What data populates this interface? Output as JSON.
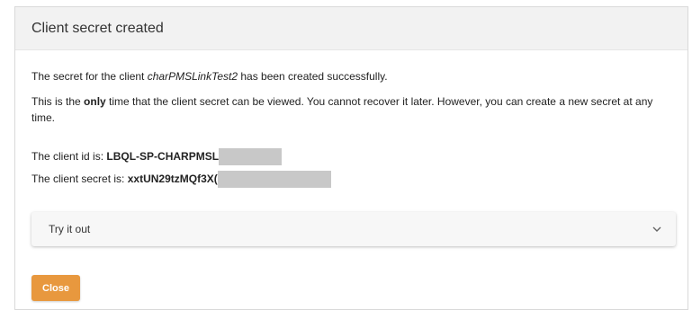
{
  "dialog": {
    "title": "Client secret created",
    "message": {
      "prefix": "The secret for the client ",
      "client_name": "charPMSLinkTest2",
      "suffix": " has been created successfully."
    },
    "warning": {
      "prefix": "This is the ",
      "emphasis": "only",
      "suffix": " time that the client secret can be viewed. You cannot recover it later. However, you can create a new secret at any time."
    },
    "client_id": {
      "label": "The client id is: ",
      "value": "LBQL-SP-CHARPMSL"
    },
    "client_secret": {
      "label": "The client secret is: ",
      "value": "xxtUN29tzMQf3X("
    },
    "try_it_out": {
      "label": "Try it out",
      "icon": "chevron-down-icon"
    },
    "close_button": {
      "label": "Close",
      "color": "#e8983e"
    }
  }
}
